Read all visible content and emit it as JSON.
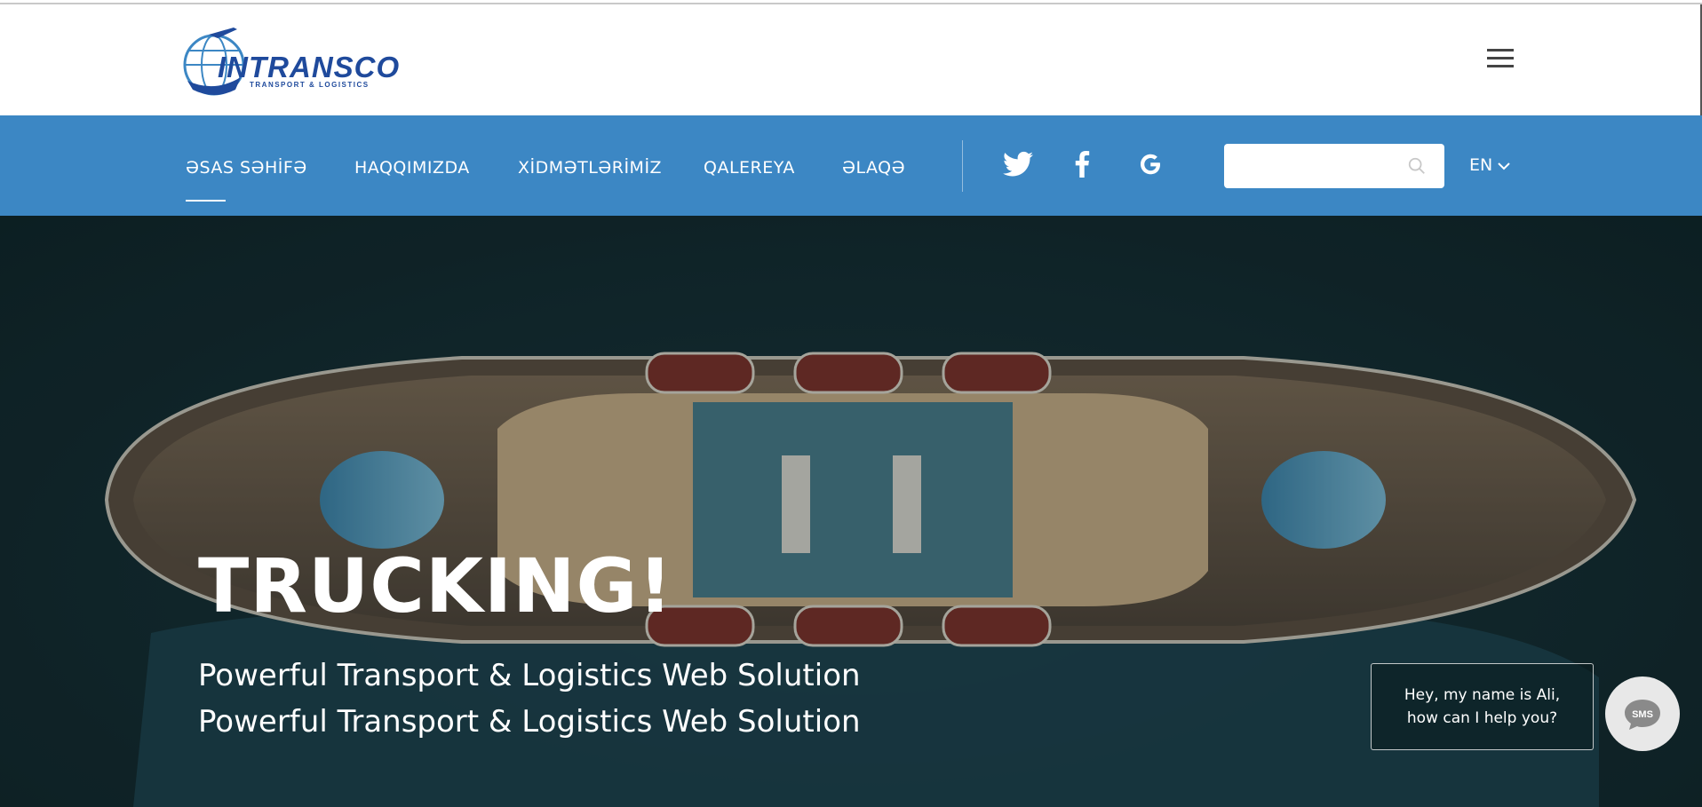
{
  "header": {
    "logo": {
      "brand": "INTRANSCO",
      "tagline": "TRANSPORT & LOGISTICS"
    },
    "menu_icon": "hamburger-icon"
  },
  "nav": {
    "items": [
      {
        "label": "ƏSAS SƏHİFƏ",
        "active": true
      },
      {
        "label": "HAQQIMIZDA",
        "active": false
      },
      {
        "label": "XİDMƏTLƏRİMİZ",
        "active": false
      },
      {
        "label": "QALEREYA",
        "active": false
      },
      {
        "label": "ƏLAQƏ",
        "active": false
      }
    ],
    "social": [
      "twitter-icon",
      "facebook-icon",
      "google-icon"
    ],
    "search": {
      "value": "",
      "placeholder": ""
    },
    "language": "EN"
  },
  "hero": {
    "title": "TRUCKING!",
    "subtitle_1": "Powerful Transport & Logistics Web Solution",
    "subtitle_2": "Powerful Transport & Logistics Web Solution"
  },
  "chat": {
    "message_line1": "Hey, my name is Ali,",
    "message_line2": "how can I help you?",
    "button_label": "SMS"
  },
  "colors": {
    "nav_background": "#3c87c4",
    "brand_blue": "#1f4a9c",
    "hero_dark": "#132a2f"
  }
}
